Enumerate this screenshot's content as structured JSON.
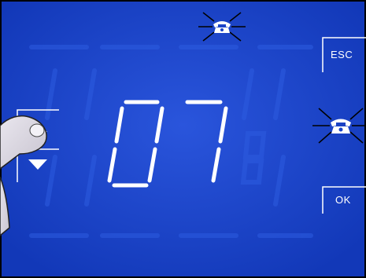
{
  "display": {
    "digits": "07",
    "background_color": "#1a44c8",
    "segment_on_color": "#ffffff",
    "segment_off_color": "#2a55d8"
  },
  "buttons": {
    "esc_label": "ESC",
    "ok_label": "OK"
  },
  "icons": {
    "top": "phone-flashing-icon",
    "right": "phone-flashing-icon",
    "up": "arrow-up-icon",
    "down": "arrow-down-icon",
    "hand": "pointing-hand-icon"
  }
}
